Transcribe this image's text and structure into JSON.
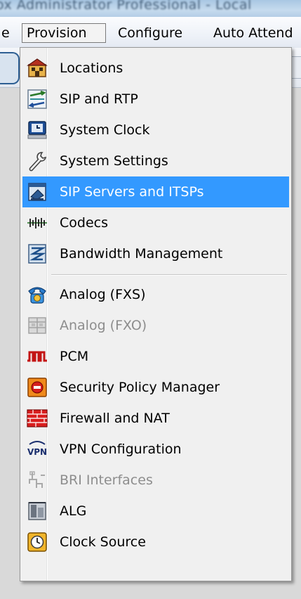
{
  "window": {
    "title_blur": "ox Administrator Professional - Local"
  },
  "menubar": {
    "items": [
      {
        "label": "e"
      },
      {
        "label": "Provision"
      },
      {
        "label": "Configure"
      },
      {
        "label": "Auto Attend"
      }
    ]
  },
  "provision_menu": {
    "items": [
      {
        "label": "Locations",
        "icon": "locations-icon",
        "enabled": true,
        "highlighted": false
      },
      {
        "label": "SIP and RTP",
        "icon": "sip-rtp-icon",
        "enabled": true,
        "highlighted": false
      },
      {
        "label": "System Clock",
        "icon": "system-clock-icon",
        "enabled": true,
        "highlighted": false
      },
      {
        "label": "System Settings",
        "icon": "wrench-icon",
        "enabled": true,
        "highlighted": false
      },
      {
        "label": "SIP Servers and ITSPs",
        "icon": "sip-servers-icon",
        "enabled": true,
        "highlighted": true
      },
      {
        "label": "Codecs",
        "icon": "codecs-icon",
        "enabled": true,
        "highlighted": false
      },
      {
        "label": "Bandwidth Management",
        "icon": "bandwidth-icon",
        "enabled": true,
        "highlighted": false
      },
      {
        "label": "Analog (FXS)",
        "icon": "phone-icon",
        "enabled": true,
        "highlighted": false
      },
      {
        "label": "Analog (FXO)",
        "icon": "fxo-icon",
        "enabled": false,
        "highlighted": false
      },
      {
        "label": "PCM",
        "icon": "pcm-icon",
        "enabled": true,
        "highlighted": false
      },
      {
        "label": "Security Policy Manager",
        "icon": "security-icon",
        "enabled": true,
        "highlighted": false
      },
      {
        "label": "Firewall and NAT",
        "icon": "firewall-icon",
        "enabled": true,
        "highlighted": false
      },
      {
        "label": "VPN Configuration",
        "icon": "vpn-icon",
        "enabled": true,
        "highlighted": false
      },
      {
        "label": "BRI Interfaces",
        "icon": "bri-icon",
        "enabled": false,
        "highlighted": false
      },
      {
        "label": "ALG",
        "icon": "alg-icon",
        "enabled": true,
        "highlighted": false
      },
      {
        "label": "Clock Source",
        "icon": "clock-source-icon",
        "enabled": true,
        "highlighted": false
      }
    ]
  },
  "colors": {
    "highlight": "#3399ff",
    "disabled_text": "#8d8d8d"
  }
}
